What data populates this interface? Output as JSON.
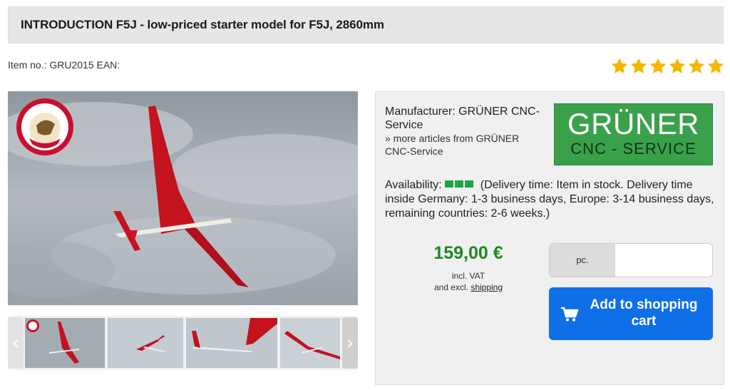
{
  "product": {
    "title": "INTRODUCTION F5J - low-priced starter model for F5J, 2860mm",
    "item_line": "Item no.:  GRU2015 EAN:",
    "rating_stars": 6
  },
  "images": {
    "main_alt": "glider in flight",
    "thumbnails": [
      "thumbnail-1",
      "thumbnail-2",
      "thumbnail-3",
      "thumbnail-4"
    ],
    "prev_icon": "chevron-left-icon",
    "next_icon": "chevron-right-icon"
  },
  "manufacturer": {
    "label": "Manufacturer: GRÜNER CNC-Service",
    "more_link": "» more articles from GRÜNER CNC-Service",
    "logo_line1": "GRÜNER",
    "logo_line2": "CNC - SERVICE"
  },
  "availability": {
    "label": "Availability:",
    "level": 3,
    "text": "(Delivery time: Item in stock. Delivery time inside Germany: 1-3 business days, Europe: 3-14 business days, remaining countries: 2-6 weeks.)"
  },
  "price": {
    "amount": "159,00 €",
    "vat": "incl. VAT",
    "excl": "and excl.",
    "shipping_link": "shipping"
  },
  "cart": {
    "unit": "pc.",
    "quantity_value": "",
    "button_label": "Add to shopping cart",
    "button_icon": "cart-icon"
  },
  "colors": {
    "price_green": "#1d8a25",
    "button_blue": "#0f6fe6",
    "star_yellow": "#f5b800",
    "logo_green": "#3aa14b"
  }
}
